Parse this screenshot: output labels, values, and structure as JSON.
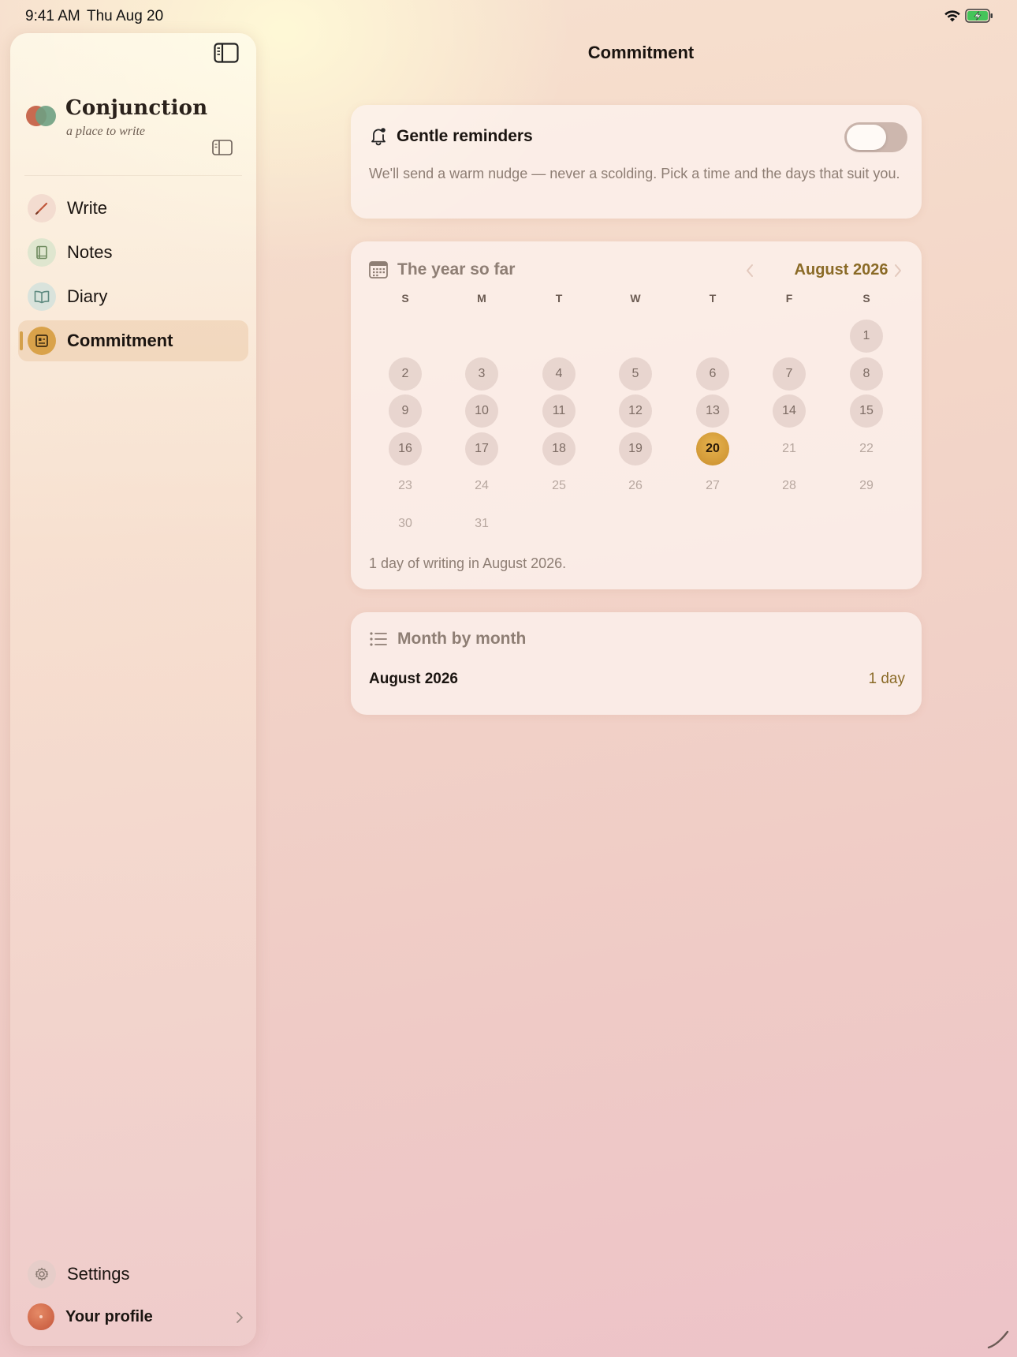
{
  "status_bar": {
    "time": "9:41 AM",
    "date": "Thu Aug 20"
  },
  "sidebar": {
    "brand": {
      "name": "Conjunction",
      "tagline": "a place to write"
    },
    "items": [
      {
        "label": "Write",
        "icon": "pencil-icon",
        "icon_bg": "#f3dcd0",
        "active": false
      },
      {
        "label": "Notes",
        "icon": "notebook-icon",
        "icon_bg": "#dfe6cf",
        "active": false
      },
      {
        "label": "Diary",
        "icon": "open-book-icon",
        "icon_bg": "#d9e3dc",
        "active": false
      },
      {
        "label": "Commitment",
        "icon": "calendar-check-icon",
        "icon_bg": "#d9a24a",
        "active": true
      }
    ],
    "settings_label": "Settings",
    "profile_label": "Your profile"
  },
  "main": {
    "title": "Commitment",
    "reminders": {
      "title": "Gentle reminders",
      "enabled": false,
      "description": "We'll send a warm nudge — never a scolding. Pick a time and the days that suit you."
    },
    "year": {
      "title": "The year so far",
      "month_label": "August 2026",
      "weekdays": [
        "S",
        "M",
        "T",
        "W",
        "T",
        "F",
        "S"
      ],
      "first_weekday_index": 6,
      "days_in_month": 31,
      "today": 20,
      "written_days": [
        20
      ],
      "summary": "1 day of writing in August 2026."
    },
    "month_by_month": {
      "title": "Month by month",
      "rows": [
        {
          "month": "August 2026",
          "count": "1 day"
        }
      ]
    }
  },
  "colors": {
    "accent": "#d9a24a",
    "accent_text": "#8a6a26",
    "muted_text": "#8e7e74"
  }
}
